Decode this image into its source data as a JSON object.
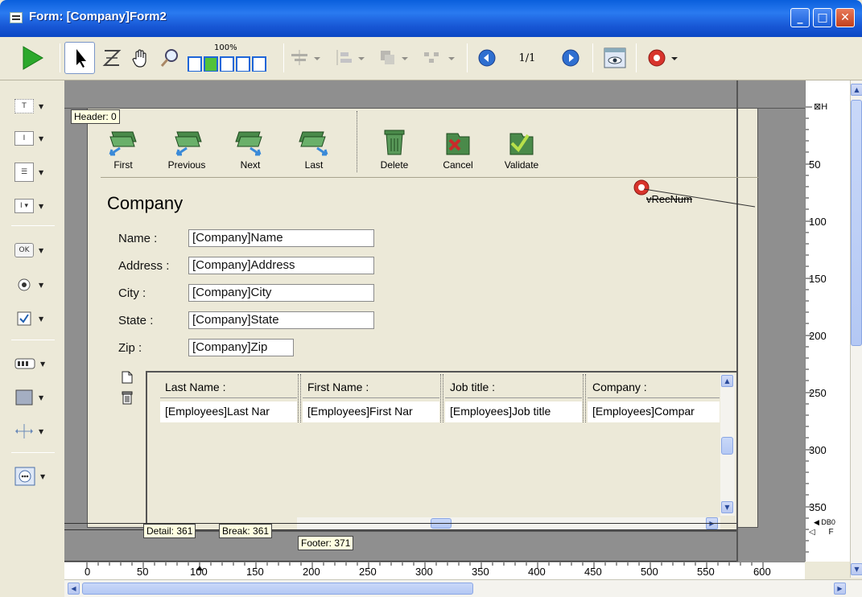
{
  "window": {
    "title": "Form: [Company]Form2",
    "buttons": [
      "_",
      "□",
      "X"
    ]
  },
  "toolbar": {
    "zoom_label": "100%",
    "page_indicator": "1/1"
  },
  "header_tag": "Header: 0",
  "nav_buttons": [
    {
      "label": "First"
    },
    {
      "label": "Previous"
    },
    {
      "label": "Next"
    },
    {
      "label": "Last"
    },
    {
      "label": "Delete"
    },
    {
      "label": "Cancel"
    },
    {
      "label": "Validate"
    }
  ],
  "form": {
    "heading": "Company",
    "var_label": "vRecNum",
    "fields": [
      {
        "label": "Name :",
        "value": "[Company]Name"
      },
      {
        "label": "Address :",
        "value": "[Company]Address"
      },
      {
        "label": "City :",
        "value": "[Company]City"
      },
      {
        "label": "State :",
        "value": "[Company]State"
      },
      {
        "label": "Zip :",
        "value": "[Company]Zip"
      }
    ]
  },
  "listbox": {
    "columns": [
      {
        "header": "Last Name :",
        "cell": "[Employees]Last Nar"
      },
      {
        "header": "First Name :",
        "cell": "[Employees]First Nar"
      },
      {
        "header": "Job title :",
        "cell": "[Employees]Job title"
      },
      {
        "header": "Company :",
        "cell": "[Employees]Compar"
      }
    ]
  },
  "markers": {
    "detail": "Detail: 361",
    "break": "Break: 361",
    "footer": "Footer: 371"
  },
  "vruler": {
    "labels": [
      "H",
      "50",
      "100",
      "150",
      "200",
      "250",
      "300",
      "350",
      "DB0",
      "F"
    ]
  },
  "hruler": {
    "labels": [
      "0",
      "50",
      "100",
      "150",
      "200",
      "250",
      "300",
      "350",
      "400",
      "450",
      "500",
      "550",
      "600"
    ]
  },
  "palette": {
    "items": [
      "text-tool",
      "field-tool",
      "list-tool",
      "combo-tool",
      "button-tool",
      "radio-tool",
      "checkbox-tool",
      "progress-tool",
      "rectangle-tool",
      "line-tool",
      "plugin-tool"
    ]
  }
}
